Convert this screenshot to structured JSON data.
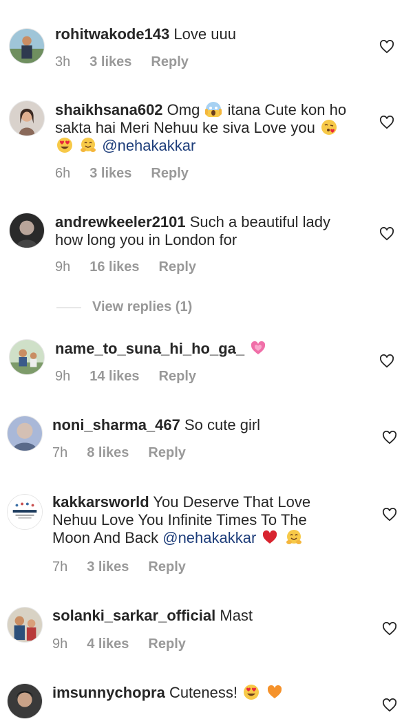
{
  "comments": [
    {
      "username": "rohitwakode143",
      "text": "Love uuu",
      "time": "3h",
      "likes": "3 likes",
      "reply": "Reply"
    },
    {
      "username": "shaikhsana602",
      "text_a": "Omg",
      "text_b": "itana Cute kon ho sakta hai Meri Nehuu ke siva Love you",
      "mention": "@nehakakkar",
      "time": "6h",
      "likes": "3 likes",
      "reply": "Reply"
    },
    {
      "username": "andrewkeeler2101",
      "text": "Such a beautiful lady how long you in London for",
      "time": "9h",
      "likes": "16 likes",
      "reply": "Reply",
      "view_replies": "View replies (1)"
    },
    {
      "username": "name_to_suna_hi_ho_ga_",
      "text": "",
      "time": "9h",
      "likes": "14 likes",
      "reply": "Reply"
    },
    {
      "username": "noni_sharma_467",
      "text": "So cute girl",
      "time": "7h",
      "likes": "8 likes",
      "reply": "Reply"
    },
    {
      "username": "kakkarsworld",
      "text": "You Deserve That Love Nehuu Love You Infinite Times To The Moon And Back",
      "mention": "@nehakakkar",
      "avatar_logo_text": "KAKKARS WORLD",
      "time": "7h",
      "likes": "3 likes",
      "reply": "Reply"
    },
    {
      "username": "solanki_sarkar_official",
      "text": "Mast",
      "time": "9h",
      "likes": "4 likes",
      "reply": "Reply"
    },
    {
      "username": "imsunnychopra",
      "text": "Cuteness!",
      "time": "",
      "likes": "",
      "reply": ""
    }
  ],
  "icons": {
    "like": "heart-outline-icon",
    "emoji_scream": "face-screaming-emoji",
    "emoji_kiss": "face-blowing-kiss-emoji",
    "emoji_hearteyes": "heart-eyes-emoji",
    "emoji_hug": "hugging-face-emoji",
    "emoji_pinkheart": "growing-heart-emoji",
    "emoji_redheart": "red-heart-emoji",
    "emoji_orangeheart": "orange-heart-emoji"
  },
  "colors": {
    "text": "#262626",
    "meta": "#8e8e8e",
    "mention": "#1d3d7a",
    "background": "#ffffff"
  }
}
